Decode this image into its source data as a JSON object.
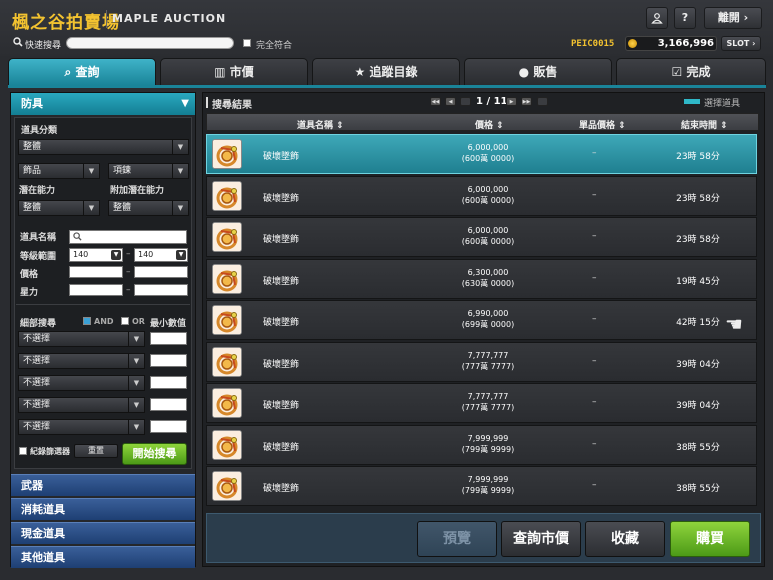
{
  "header": {
    "title_cn": "楓之谷拍賣場",
    "title_en": "MAPLE AUCTION",
    "help_label": "?",
    "exit_label": "離開 ›",
    "quick_search_label": "快速搜尋",
    "search_value": "",
    "exact_match_label": "完全符合",
    "player_name": "PEIC0015",
    "meso": "3,166,996",
    "slot_label": "SLOT ›"
  },
  "tabs": [
    {
      "label": "查詢",
      "icon": "search-icon"
    },
    {
      "label": "市價",
      "icon": "bar-chart-icon"
    },
    {
      "label": "追蹤目錄",
      "icon": "star-icon"
    },
    {
      "label": "販售",
      "icon": "coin-icon"
    },
    {
      "label": "完成",
      "icon": "check-icon"
    }
  ],
  "filters": {
    "category_header": "防具",
    "item_category_label": "道具分類",
    "item_category_value": "整體",
    "sub1_value": "飾品",
    "sub2_value": "項鍊",
    "potential_label": "潛在能力",
    "bonus_potential_label": "附加潛在能力",
    "potential_value": "整體",
    "bonus_potential_value": "整體",
    "item_name_label": "道具名稱",
    "level_range_label": "等級範圍",
    "level_min": "140",
    "level_max": "140",
    "price_label": "價格",
    "star_label": "星力",
    "detail_search_label": "細部搜尋",
    "and_label": "AND",
    "or_label": "OR",
    "min_value_label": "最小數值",
    "detail_rows": [
      "不選擇",
      "不選擇",
      "不選擇",
      "不選擇",
      "不選擇"
    ],
    "record_filter_label": "紀錄篩選器",
    "reset_label": "重置",
    "start_search_label": "開始搜尋"
  },
  "categories": [
    "武器",
    "消耗道具",
    "現金道具",
    "其他道具"
  ],
  "results": {
    "title": "搜尋結果",
    "page_current": "1",
    "page_total": "11",
    "page_sep": "/",
    "selected_legend": "選擇道具",
    "columns": [
      "道具名稱",
      "價格",
      "單品價格",
      "結束時間"
    ],
    "rows": [
      {
        "name": "破壞墜飾",
        "price": "6,000,000",
        "price_sub": "(600萬 0000)",
        "unit": "–",
        "time": "23時 58分",
        "selected": true
      },
      {
        "name": "破壞墜飾",
        "price": "6,000,000",
        "price_sub": "(600萬 0000)",
        "unit": "–",
        "time": "23時 58分",
        "selected": false
      },
      {
        "name": "破壞墜飾",
        "price": "6,000,000",
        "price_sub": "(600萬 0000)",
        "unit": "–",
        "time": "23時 58分",
        "selected": false
      },
      {
        "name": "破壞墜飾",
        "price": "6,300,000",
        "price_sub": "(630萬 0000)",
        "unit": "–",
        "time": "19時 45分",
        "selected": false
      },
      {
        "name": "破壞墜飾",
        "price": "6,990,000",
        "price_sub": "(699萬 0000)",
        "unit": "–",
        "time": "42時 15分",
        "selected": false
      },
      {
        "name": "破壞墜飾",
        "price": "7,777,777",
        "price_sub": "(777萬 7777)",
        "unit": "–",
        "time": "39時 04分",
        "selected": false
      },
      {
        "name": "破壞墜飾",
        "price": "7,777,777",
        "price_sub": "(777萬 7777)",
        "unit": "–",
        "time": "39時 04分",
        "selected": false
      },
      {
        "name": "破壞墜飾",
        "price": "7,999,999",
        "price_sub": "(799萬 9999)",
        "unit": "–",
        "time": "38時 55分",
        "selected": false
      },
      {
        "name": "破壞墜飾",
        "price": "7,999,999",
        "price_sub": "(799萬 9999)",
        "unit": "–",
        "time": "38時 55分",
        "selected": false
      }
    ]
  },
  "actions": {
    "preview": "預覽",
    "market_price": "查詢市價",
    "favorite": "收藏",
    "buy": "購買"
  }
}
